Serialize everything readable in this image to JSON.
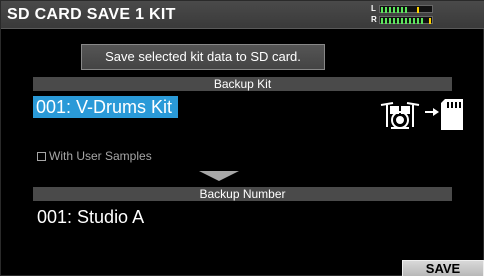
{
  "header": {
    "title": "SD CARD SAVE 1 KIT",
    "meter": {
      "left_label": "L",
      "right_label": "R",
      "left_level": 0.55,
      "right_level": 0.85
    }
  },
  "info_text": "Save selected kit data to SD card.",
  "backup_kit": {
    "label": "Backup Kit",
    "value": "001: V-Drums Kit"
  },
  "option": {
    "label": "With User Samples",
    "checked": false
  },
  "backup_number": {
    "label": "Backup Number",
    "value": "001: Studio A"
  },
  "icons": {
    "source": "drum-kit-icon",
    "arrow": "arrow-right-icon",
    "target": "sd-card-icon"
  },
  "footer": {
    "save_label": "SAVE"
  },
  "colors": {
    "highlight": "#2a9ad8",
    "header": "#3a3a3a",
    "meter_green": "#5ce75c",
    "meter_peak": "#ffd400"
  }
}
